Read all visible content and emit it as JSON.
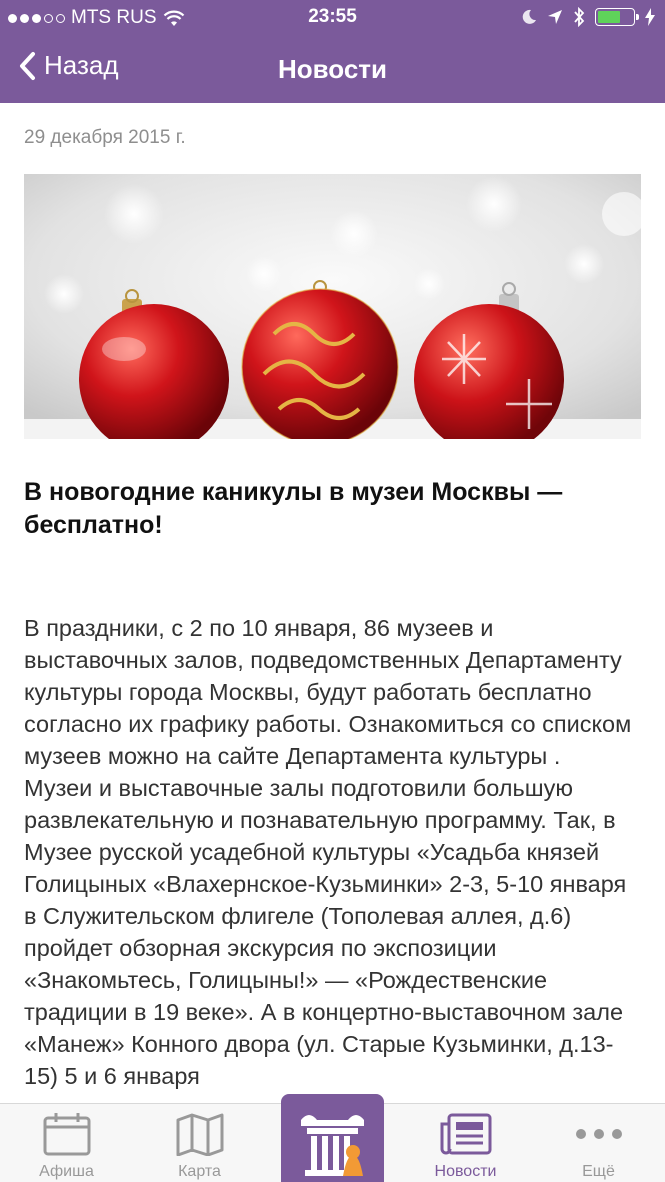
{
  "status_bar": {
    "carrier": "MTS RUS",
    "time": "23:55"
  },
  "nav": {
    "back_label": "Назад",
    "title": "Новости"
  },
  "article": {
    "date": "29 декабря 2015 г.",
    "title": "В новогодние каникулы в музеи Москвы — бесплатно!",
    "body": "В праздники, с 2 по 10 января, 86 музеев и выставочных залов, подведомственных Департаменту культуры города Москвы, будут работать бесплатно согласно их графику работы. Ознакомиться со списком музеев можно на сайте Департамента культуры .\nМузеи и выставочные залы подготовили большую развлекательную и познавательную программу. Так, в Музее русской усадебной культуры «Усадьба князей Голицыных «Влахернское-Кузьминки» 2-3, 5-10 января в Служительском флигеле (Тополевая аллея, д.6) пройдет обзорная экскурсия по экспозиции «Знакомьтесь, Голицыны!» — «Рождественские традиции в 19 веке». А в концертно-выставочном зале «Манеж» Конного двора (ул. Старые Кузьминки, д.13-15) 5 и 6 января"
  },
  "tabbar": {
    "items": [
      {
        "label": "Афиша",
        "icon": "calendar-icon"
      },
      {
        "label": "Карта",
        "icon": "map-icon"
      },
      {
        "label": "",
        "icon": "museum-column-icon"
      },
      {
        "label": "Новости",
        "icon": "news-icon"
      },
      {
        "label": "Ещё",
        "icon": "more-icon"
      }
    ],
    "active_index": 3
  },
  "colors": {
    "brand": "#7b5a9b",
    "battery": "#5fd35a",
    "inactive_tab": "#999999"
  }
}
